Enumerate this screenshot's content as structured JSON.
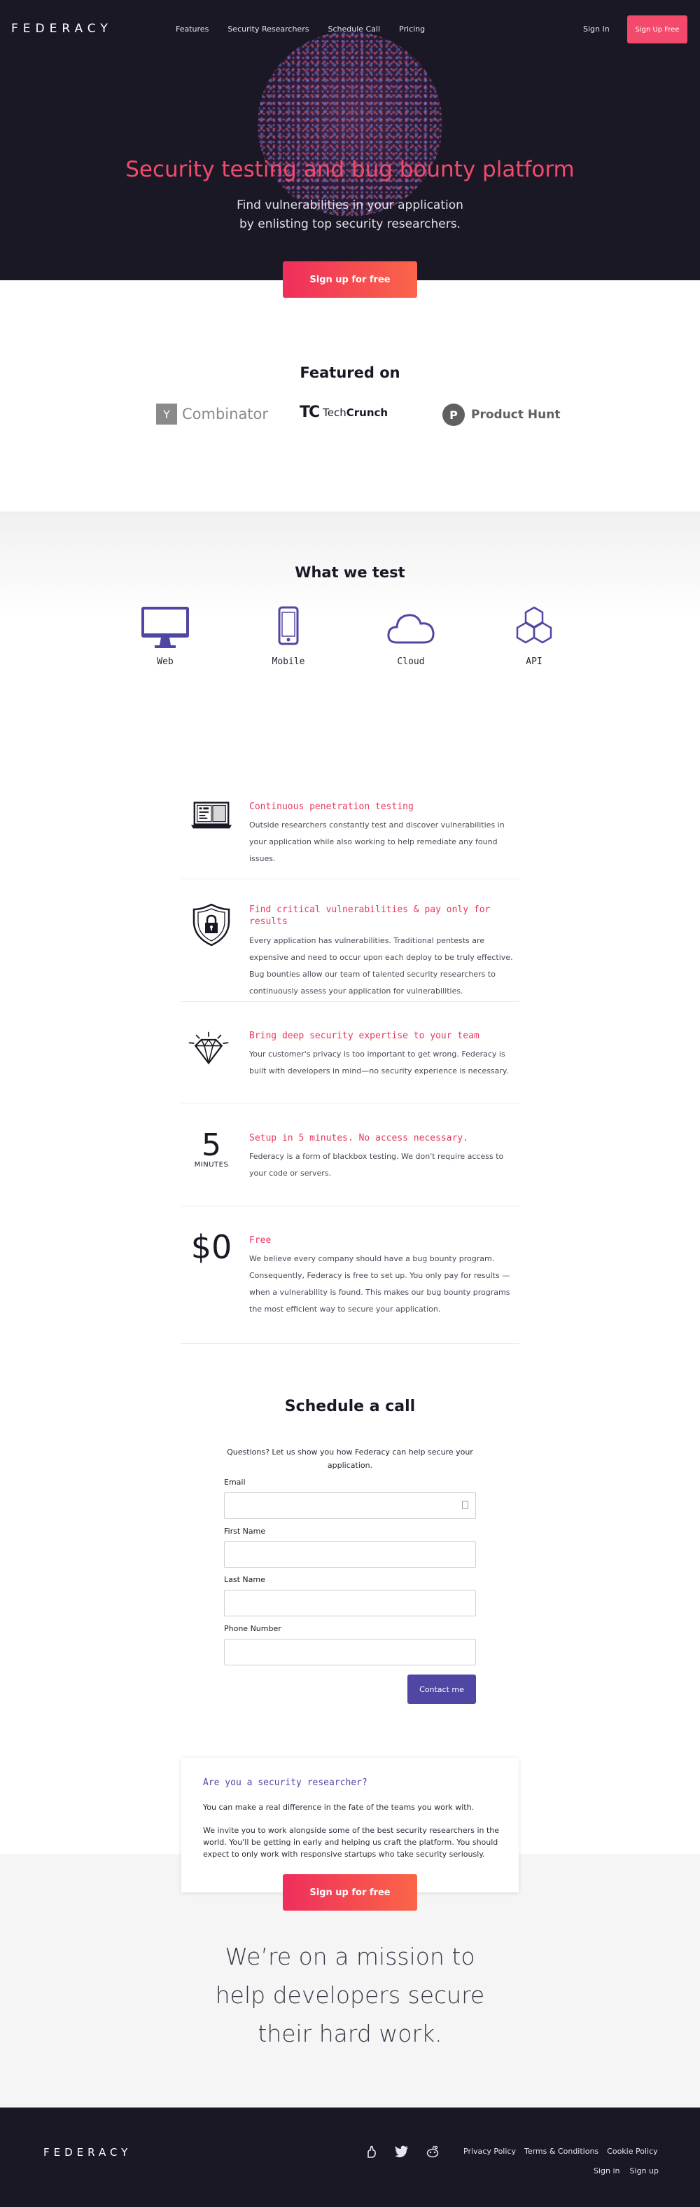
{
  "brand": {
    "logo": "FEDERACY",
    "accent": "#f34a6c",
    "purple": "#5047a4",
    "dark": "#1b1826"
  },
  "nav": {
    "links": [
      "Features",
      "Security Researchers",
      "Schedule Call",
      "Pricing"
    ],
    "sign_in": "Sign In",
    "sign_up": "Sign Up Free"
  },
  "hero": {
    "title": "Security testing and bug bounty platform",
    "subtitle_line1": "Find vulnerabilities in your application",
    "subtitle_line2": "by enlisting top security researchers.",
    "cta": "Sign up for free"
  },
  "featured": {
    "title": "Featured on",
    "yc_mark": "Y",
    "yc_text": "Combinator",
    "tc_mark": "TC",
    "tc_text_a": "Tech",
    "tc_text_b": "Crunch",
    "ph_mark": "P",
    "ph_text": "Product Hunt"
  },
  "what_we_test": {
    "title": "What we test",
    "items": [
      {
        "label": "Web",
        "icon": "monitor-icon"
      },
      {
        "label": "Mobile",
        "icon": "phone-icon"
      },
      {
        "label": "Cloud",
        "icon": "cloud-icon"
      },
      {
        "label": "API",
        "icon": "hexagons-icon"
      }
    ]
  },
  "features": [
    {
      "icon": "laptop-code-icon",
      "title": "Continuous penetration testing",
      "body": "Outside researchers constantly test and discover vulnerabilities in your application while also working to help remediate any found issues."
    },
    {
      "icon": "shield-lock-icon",
      "title": "Find critical vulnerabilities & pay only for results",
      "body": "Every application has vulnerabilities. Traditional pentests are expensive and need to occur upon each deploy to be truly effective. Bug bounties allow our team of talented security researchers to continuously assess your application for vulnerabilities."
    },
    {
      "icon": "diamond-icon",
      "title": "Bring deep security expertise to your team",
      "body": "Your customer's privacy is too important to get wrong. Federacy is built with developers in mind—no security experience is necessary."
    },
    {
      "icon": "",
      "number": "5",
      "unit": "MINUTES",
      "title": "Setup in 5 minutes. No access necessary.",
      "body": "Federacy is a form of blackbox testing. We don't require access to your code or servers."
    },
    {
      "icon": "",
      "number": "$0",
      "title": "Free",
      "body": "We believe every company should have a bug bounty program. Consequently, Federacy is free to set up. You only pay for results — when a vulnerability is found. This makes our bug bounty programs the most efficient way to secure your application."
    }
  ],
  "schedule": {
    "title": "Schedule a call",
    "subtitle": "Questions? Let us show you how Federacy can help secure your application.",
    "fields": [
      {
        "label": "Email",
        "value": ""
      },
      {
        "label": "First Name",
        "value": ""
      },
      {
        "label": "Last Name",
        "value": ""
      },
      {
        "label": "Phone Number",
        "value": ""
      }
    ],
    "submit": "Contact me"
  },
  "researcher": {
    "title": "Are you a security researcher?",
    "p1": "You can make a real difference in the fate of the teams you work with.",
    "p2": "We invite you to work alongside some of the best security researchers in the world. You'll be getting in early and helping us craft the platform. You should expect to only work with responsive startups who take security seriously.",
    "cta": "Sign up for free"
  },
  "mission": {
    "line1": "We’re on a mission to",
    "line2": "help developers secure",
    "line3": "their hard work."
  },
  "footer": {
    "logo": "FEDERACY",
    "icons": [
      "angellist-icon",
      "twitter-icon",
      "reddit-icon"
    ],
    "links": [
      "Privacy Policy",
      "Terms & Conditions",
      "Cookie Policy"
    ],
    "sign_in": "Sign in",
    "sign_up": "Sign up"
  }
}
